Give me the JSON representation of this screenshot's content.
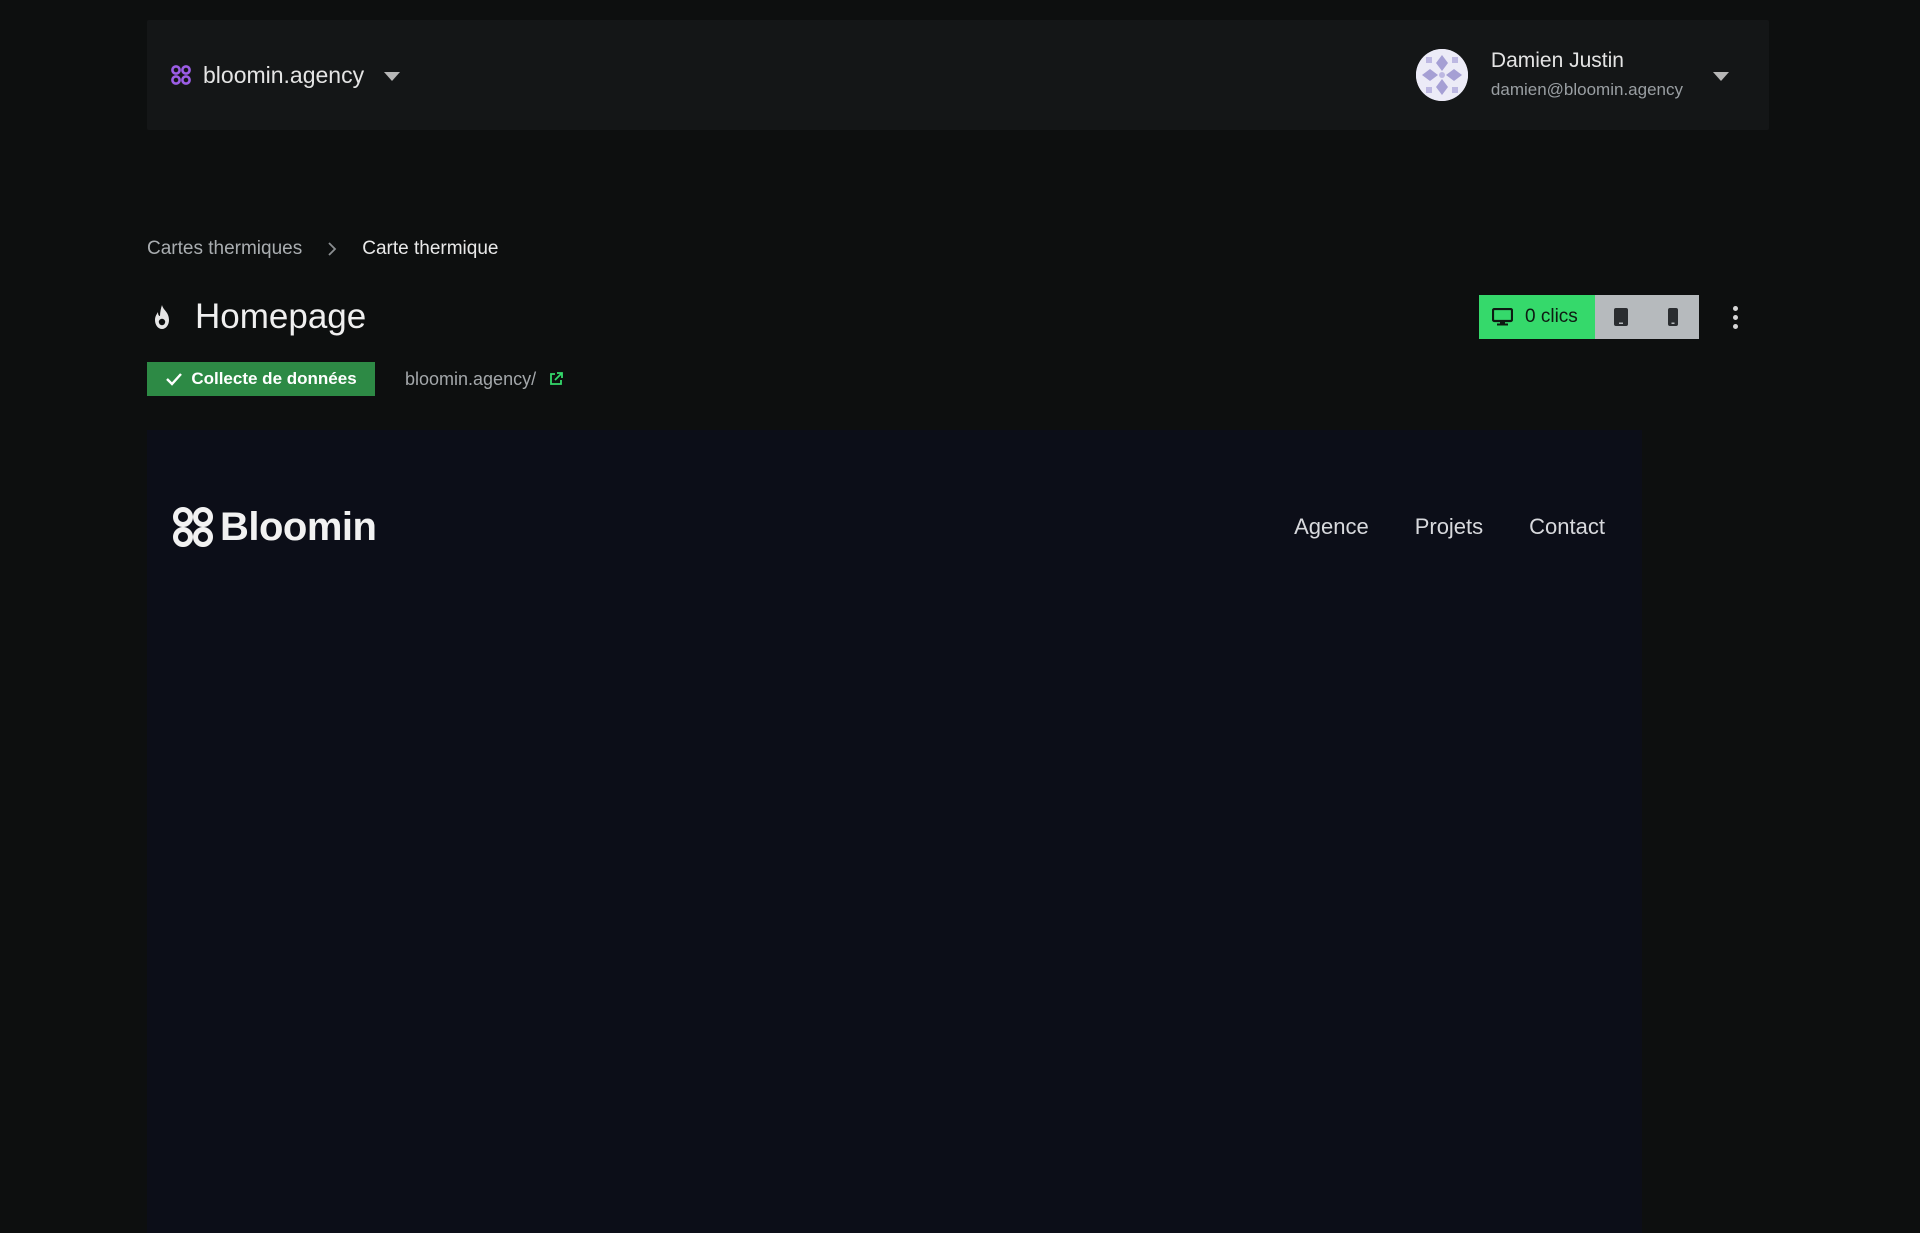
{
  "header": {
    "org_name": "bloomin.agency",
    "user_name": "Damien Justin",
    "user_email": "damien@bloomin.agency"
  },
  "breadcrumb": {
    "parent": "Cartes thermiques",
    "current": "Carte thermique"
  },
  "page": {
    "title": "Homepage",
    "status": "Collecte de données",
    "url": "bloomin.agency/"
  },
  "device_switch": {
    "desktop_clicks": "0 clics",
    "active": "desktop"
  },
  "preview": {
    "brand_name": "Bloomin",
    "nav": [
      "Agence",
      "Projets",
      "Contact"
    ]
  },
  "colors": {
    "accent_green": "#35d96b",
    "status_green": "#2d8a45",
    "brand_purple": "#9b5de5"
  },
  "icons": [
    "org-logo-icon",
    "chevron-down-icon",
    "chevron-right-icon",
    "flame-icon",
    "desktop-icon",
    "tablet-icon",
    "mobile-icon",
    "more-vertical-icon",
    "check-icon",
    "external-link-icon",
    "bloomin-logo-icon"
  ]
}
